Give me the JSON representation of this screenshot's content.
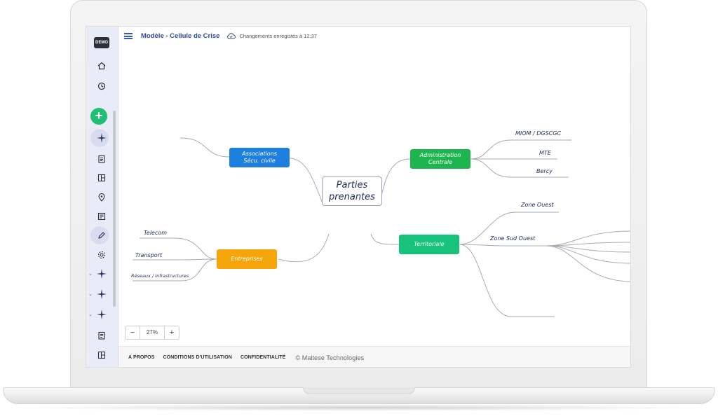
{
  "app": {
    "logo_text": "DEMO",
    "title": "Modèle - Cellule de Crise",
    "save_status": "Changements enregistés à 12:37"
  },
  "sidebar": {
    "icons": [
      "home-icon",
      "history-icon",
      "add-icon",
      "sparkle-icon",
      "clipboard-icon",
      "layout-icon",
      "location-icon",
      "notes-icon",
      "edit-icon",
      "settings-icon",
      "sparkle-icon",
      "sparkle-icon",
      "sparkle-icon",
      "clipboard-icon",
      "layout-icon"
    ]
  },
  "mindmap": {
    "central": {
      "line1": "Parties",
      "line2": "prenantes"
    },
    "branches": {
      "associations": {
        "line1": "Associations",
        "line2": "Sécu. civile",
        "color": "#1d7fe0"
      },
      "administration": {
        "line1": "Administration",
        "line2": "Centrale",
        "color": "#1db54e"
      },
      "entreprises": {
        "label": "Entreprises",
        "color": "#f5a40a"
      },
      "territoriale": {
        "label": "Territoriale",
        "color": "#17c27a"
      }
    },
    "leaves": {
      "admin": [
        "MIOM / DGSCGC",
        "MTE",
        "Bercy"
      ],
      "territoriale": [
        "Zone Ouest",
        "Zone Sud Ouest"
      ],
      "entreprises": [
        "Telecom",
        "Transport",
        "Réseaux / Infrastructures"
      ]
    },
    "line_color": "#a7abb4"
  },
  "zoom": {
    "minus": "−",
    "value": "27%",
    "plus": "+"
  },
  "footer": {
    "about": "A PROPOS",
    "terms": "CONDITIONS D'UTILISATION",
    "privacy": "CONFIDENTIALITÉ",
    "copyright": "© Maltese Technologies"
  }
}
